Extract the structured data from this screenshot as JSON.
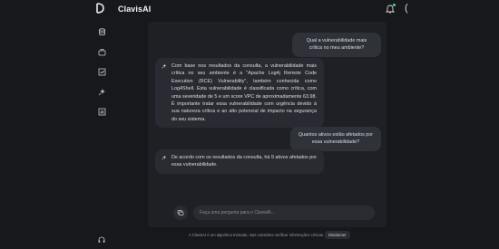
{
  "app": {
    "title": "ClavisAI"
  },
  "icons": {
    "logo": "clavis-logo-icon",
    "notifications": "bell-icon",
    "sidebar": [
      "database-icon",
      "briefcase-icon",
      "chart-icon",
      "ai-sparkle-icon",
      "report-icon"
    ],
    "help": "headset-icon",
    "attach": "attachment-icon"
  },
  "colors": {
    "notification_dot": "#4ade80",
    "background": "#17181c",
    "panel": "#1f2025"
  },
  "topbar": {
    "paren": "("
  },
  "messages": [
    {
      "role": "user",
      "text": "Qual a vulnerabilidade mais crítica no meu ambiente?"
    },
    {
      "role": "assistant",
      "text": "Com base nos resultados da consulta, a vulnerabilidade mais crítica no seu ambiente é a \"Apache Log4j Remote Code Execution (RCE) Vulnerability\", também conhecida como Log4Shell. Esta vulnerabilidade é classificada como crítica, com uma severidade de 5 e um score VPC de aproximadamente 63.98. É importante tratar essa vulnerabilidade com urgência devido à sua natureza crítica e ao alto potencial de impacto na segurança do seu sistema."
    },
    {
      "role": "user",
      "text": "Quantos ativos estão afetados por essa vulnerabilidade?"
    },
    {
      "role": "assistant",
      "text": "De acordo com os resultados da consulta, há 9 ativos afetados por essa vulnerabilidade."
    }
  ],
  "input": {
    "placeholder": "Faça uma pergunta para o ClavisAI..."
  },
  "footer": {
    "note": "A ClavisAI é um algoritmo treinado, mas considere verificar informações críticas.",
    "disclaimer_label": "Disclaimer"
  }
}
